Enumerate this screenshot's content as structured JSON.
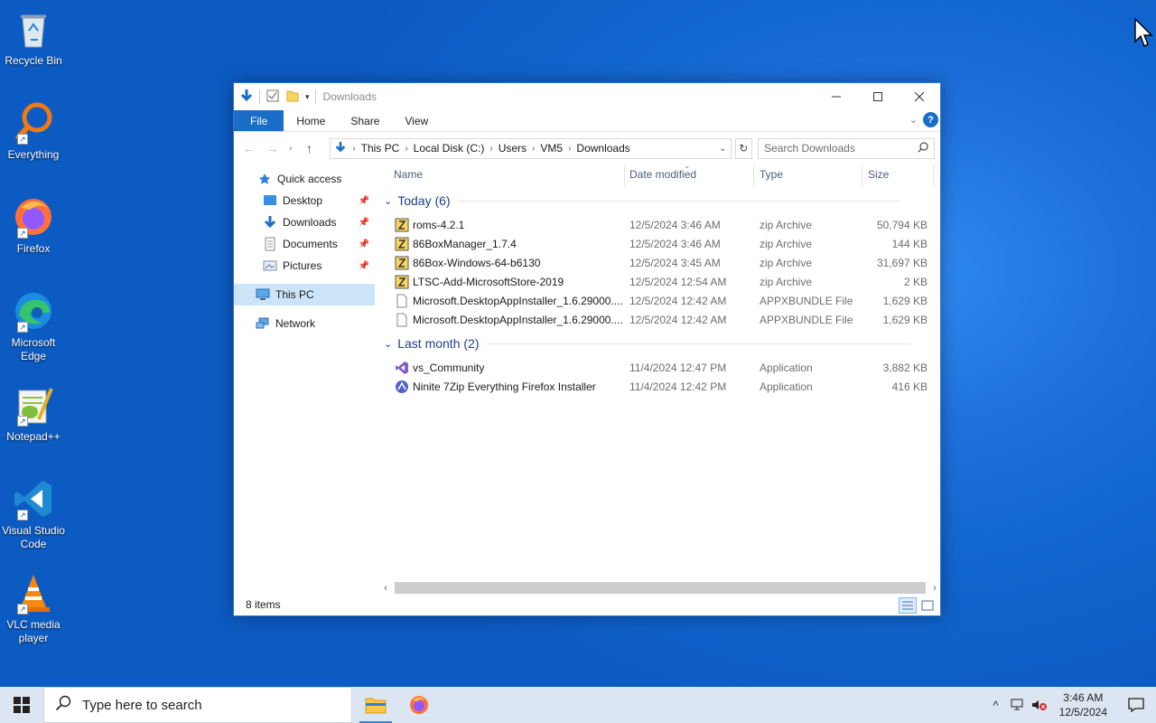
{
  "desktop": {
    "icons": [
      {
        "label": "Recycle Bin",
        "icon": "recycle-bin-icon"
      },
      {
        "label": "Everything",
        "icon": "everything-search-icon"
      },
      {
        "label": "Firefox",
        "icon": "firefox-icon"
      },
      {
        "label": "Microsoft Edge",
        "icon": "edge-icon"
      },
      {
        "label": "Notepad++",
        "icon": "notepad-plus-plus-icon"
      },
      {
        "label": "Visual Studio Code",
        "icon": "vscode-icon"
      },
      {
        "label": "VLC media player",
        "icon": "vlc-icon"
      }
    ]
  },
  "window": {
    "title": "Downloads",
    "ribbon_tabs": [
      "File",
      "Home",
      "Share",
      "View"
    ],
    "help": "?",
    "breadcrumb": [
      "This PC",
      "Local Disk (C:)",
      "Users",
      "VM5",
      "Downloads"
    ],
    "search_placeholder": "Search Downloads",
    "columns": {
      "name": "Name",
      "date": "Date modified",
      "type": "Type",
      "size": "Size"
    },
    "nav": {
      "quick_access": "Quick access",
      "pinned": [
        "Desktop",
        "Downloads",
        "Documents",
        "Pictures"
      ],
      "this_pc": "This PC",
      "network": "Network"
    },
    "groups": [
      {
        "label": "Today (6)",
        "files": [
          {
            "name": "roms-4.2.1",
            "date": "12/5/2024 3:46 AM",
            "type": "zip Archive",
            "size": "50,794 KB",
            "icon": "zip-icon"
          },
          {
            "name": "86BoxManager_1.7.4",
            "date": "12/5/2024 3:46 AM",
            "type": "zip Archive",
            "size": "144 KB",
            "icon": "zip-icon"
          },
          {
            "name": "86Box-Windows-64-b6130",
            "date": "12/5/2024 3:45 AM",
            "type": "zip Archive",
            "size": "31,697 KB",
            "icon": "zip-icon"
          },
          {
            "name": "LTSC-Add-MicrosoftStore-2019",
            "date": "12/5/2024 12:54 AM",
            "type": "zip Archive",
            "size": "2 KB",
            "icon": "zip-icon"
          },
          {
            "name": "Microsoft.DesktopAppInstaller_1.6.29000....",
            "date": "12/5/2024 12:42 AM",
            "type": "APPXBUNDLE File",
            "size": "1,629 KB",
            "icon": "blank-file-icon"
          },
          {
            "name": "Microsoft.DesktopAppInstaller_1.6.29000....",
            "date": "12/5/2024 12:42 AM",
            "type": "APPXBUNDLE File",
            "size": "1,629 KB",
            "icon": "blank-file-icon"
          }
        ]
      },
      {
        "label": "Last month (2)",
        "files": [
          {
            "name": "vs_Community",
            "date": "11/4/2024 12:47 PM",
            "type": "Application",
            "size": "3,882 KB",
            "icon": "visual-studio-icon"
          },
          {
            "name": "Ninite 7Zip Everything Firefox Installer",
            "date": "11/4/2024 12:42 PM",
            "type": "Application",
            "size": "416 KB",
            "icon": "ninite-icon"
          }
        ]
      }
    ],
    "status": "8 items"
  },
  "taskbar": {
    "search_placeholder": "Type here to search",
    "time": "3:46 AM",
    "date": "12/5/2024"
  }
}
